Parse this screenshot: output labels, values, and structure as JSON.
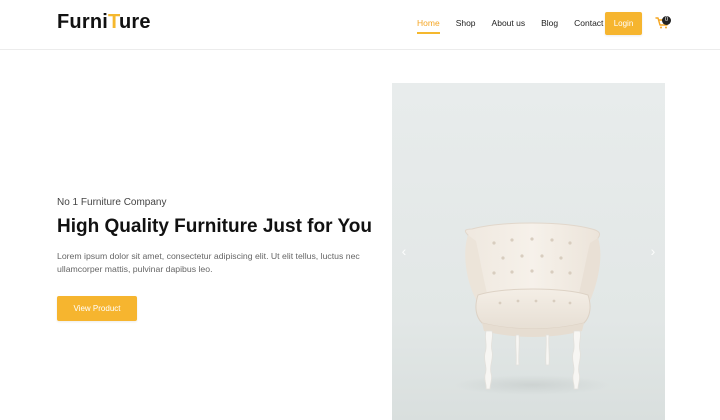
{
  "brand": {
    "logo_part1": "Furni",
    "logo_accent": "T",
    "logo_part2": "ure",
    "accent_color": "#f5b82e"
  },
  "nav": {
    "items": [
      "Home",
      "Shop",
      "About us",
      "Blog",
      "Contact"
    ],
    "active": "Home",
    "login_label": "Login",
    "cart_count": "0"
  },
  "hero": {
    "eyebrow": "No 1 Furniture Company",
    "title": "High Quality Furniture Just for You",
    "description": "Lorem ipsum dolor sit amet, consectetur adipiscing elit. Ut elit tellus, luctus nec ullamcorper mattis, pulvinar dapibus leo.",
    "cta_label": "View Product"
  },
  "slider": {
    "prev_icon": "chevron-left-icon",
    "next_icon": "chevron-right-icon"
  }
}
